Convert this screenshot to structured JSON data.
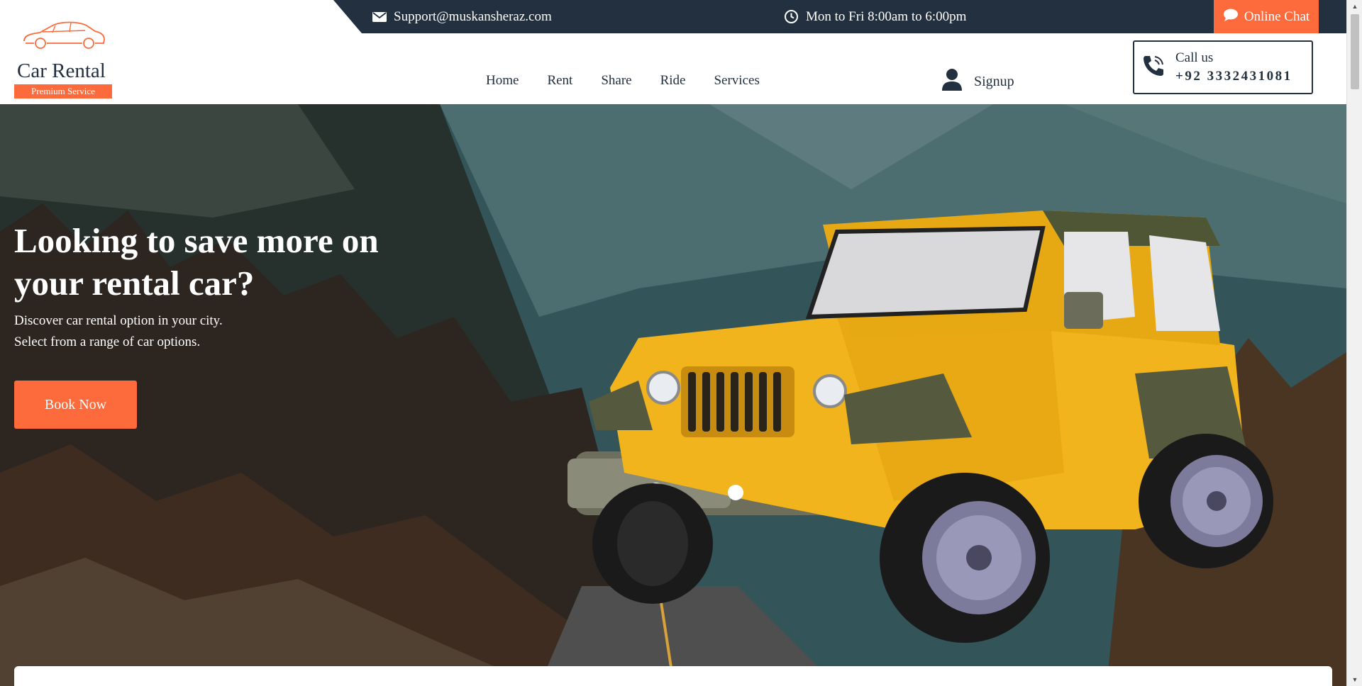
{
  "topbar": {
    "email": "Support@muskansheraz.com",
    "hours": "Mon to Fri 8:00am to 6:00pm",
    "chat_label": "Online Chat",
    "icons": {
      "email": "envelope-icon",
      "hours": "clock-icon",
      "chat": "chat-bubble-icon"
    }
  },
  "logo": {
    "name": "Car Rental",
    "tagline": "Premium Service",
    "icon": "car-outline-icon"
  },
  "nav": {
    "items": [
      "Home",
      "Rent",
      "Share",
      "Ride",
      "Services"
    ]
  },
  "account": {
    "signup_label": "Signup",
    "icon": "user-icon"
  },
  "call": {
    "label": "Call us",
    "number": "+92 3332431081",
    "icon": "phone-icon"
  },
  "hero": {
    "title": "Looking to save more on your rental car?",
    "subtitle_line1": "Discover car rental option in your city.",
    "subtitle_line2": "Select from a range of car options.",
    "button_label": "Book Now",
    "image": "yellow-jeep-on-mountain-road"
  },
  "colors": {
    "accent": "#fd6a3b",
    "dark": "#22303f",
    "white": "#ffffff"
  }
}
